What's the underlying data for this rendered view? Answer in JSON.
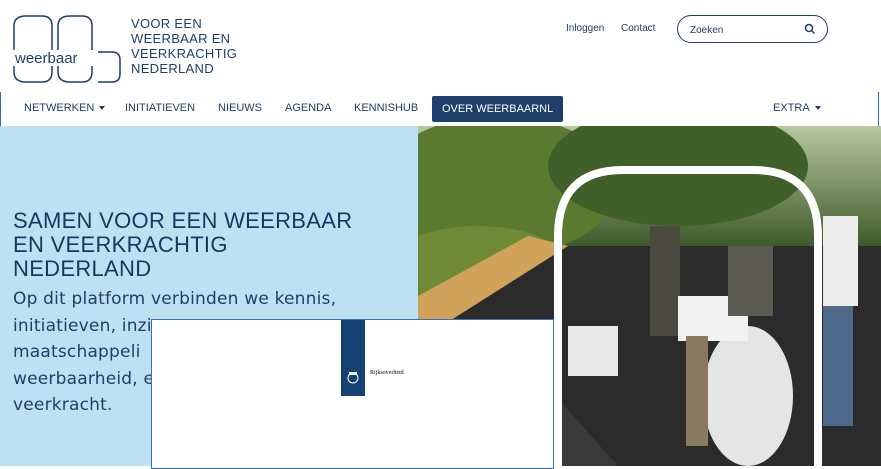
{
  "logo": {
    "wordmark": "weerbaar",
    "tagline": [
      "VOOR EEN",
      "WEERBAAR EN",
      "VEERKRACHTIG",
      "NEDERLAND"
    ]
  },
  "toplinks": {
    "login": "Inloggen",
    "contact": "Contact"
  },
  "search": {
    "placeholder": "Zoeken"
  },
  "nav": {
    "items": [
      "NETWERKEN",
      "INITIATIEVEN",
      "NIEUWS",
      "AGENDA",
      "KENNISHUB",
      "OVER WEERBAARNL"
    ],
    "extra": "EXTRA"
  },
  "hero": {
    "title_lines": [
      "SAMEN VOOR EEN WEERBAAR",
      "EN VEERKRACHTIG",
      "NEDERLAND"
    ],
    "desc_lines": [
      "Op dit platform verbinden we kennis,",
      "initiatieven, inzi",
      "maatschappeli",
      "weerbaarheid, e",
      "veerkracht."
    ]
  },
  "modal": {
    "label": "Rijksoverheid"
  },
  "colors": {
    "navy": "#1e3f6a",
    "hero_bg": "#bee0f3"
  }
}
